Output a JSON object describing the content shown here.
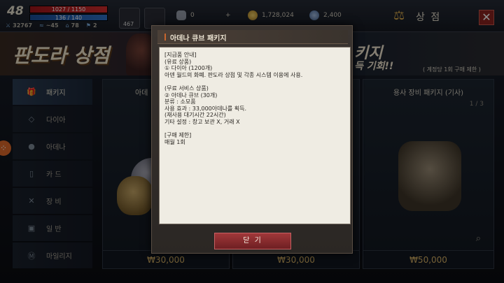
{
  "player": {
    "level": "48",
    "hp": "1027 / 1150",
    "mp": "136 / 140",
    "stat1": "32767",
    "stat2": "~45",
    "stat3": "78",
    "stat4": "2"
  },
  "topbar": {
    "slot_badge": "467",
    "gem_count": "0",
    "plus": "+",
    "gold": "1,728,024",
    "mileage": "2,400",
    "shop_title": "상 점",
    "close": "✕"
  },
  "banner": {
    "title": "판도라 상점",
    "right_big": "키지",
    "right_small": "득 기회!!",
    "note": "( 계정당 1회 구매 제한 )"
  },
  "sidebar": {
    "items": [
      {
        "label": "패키지",
        "icon": "gift-icon"
      },
      {
        "label": "다이아",
        "icon": "diamond-icon"
      },
      {
        "label": "아데나",
        "icon": "coins-icon"
      },
      {
        "label": "카 드",
        "icon": "card-icon"
      },
      {
        "label": "장 비",
        "icon": "swords-icon"
      },
      {
        "label": "일 반",
        "icon": "box-icon"
      },
      {
        "label": "마일리지",
        "icon": "mileage-icon"
      }
    ]
  },
  "cards": {
    "card1": {
      "title": "아데",
      "price": "₩30,000"
    },
    "card2": {
      "price": "₩30,000"
    },
    "card3": {
      "title": "용사 장비 패키지 (기사)",
      "page": "1 / 3",
      "price": "₩50,000"
    }
  },
  "modal": {
    "title": "아데나 큐브 패키지",
    "body": "[지급품 안내]\n(유료 상품)\n① 다이아 (1200개)\n아덴 월드의 화폐. 판도라 상점 및 각종 시스템 이용에 사용.\n\n(무료 서비스 상품)\n② 아데나 큐브 (30개)\n분류 : 소모품\n사용 효과 : 33,000아데나를 획득.\n(재사용 대기시간 22시간)\n기타 설정 : 창고 보관 X, 거래 X\n\n[구매 제한]\n매월 1회",
    "close_label": "닫 기"
  }
}
